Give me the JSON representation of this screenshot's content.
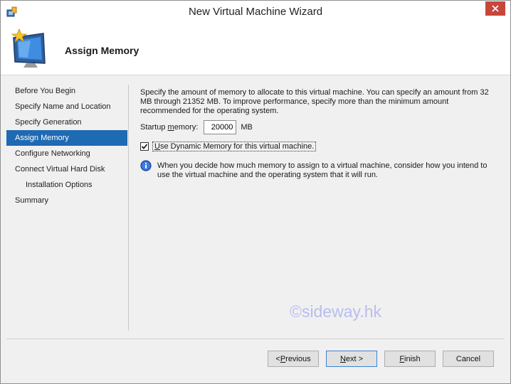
{
  "window": {
    "title": "New Virtual Machine Wizard",
    "close_glyph": "✕"
  },
  "header": {
    "title": "Assign Memory",
    "icon": "new-vm-monitor-icon"
  },
  "sidebar": {
    "items": [
      {
        "label": "Before You Begin",
        "active": false,
        "sub": false
      },
      {
        "label": "Specify Name and Location",
        "active": false,
        "sub": false
      },
      {
        "label": "Specify Generation",
        "active": false,
        "sub": false
      },
      {
        "label": "Assign Memory",
        "active": true,
        "sub": false
      },
      {
        "label": "Configure Networking",
        "active": false,
        "sub": false
      },
      {
        "label": "Connect Virtual Hard Disk",
        "active": false,
        "sub": false
      },
      {
        "label": "Installation Options",
        "active": false,
        "sub": true
      },
      {
        "label": "Summary",
        "active": false,
        "sub": false
      }
    ]
  },
  "main": {
    "description": "Specify the amount of memory to allocate to this virtual machine. You can specify an amount from 32 MB through 21352 MB. To improve performance, specify more than the minimum amount recommended for the operating system.",
    "startup_label_pre": "Startup ",
    "startup_label_accel": "m",
    "startup_label_post": "emory:",
    "startup_value": "20000",
    "startup_unit": "MB",
    "dynamic_memory_checked": true,
    "dynamic_label_accel": "U",
    "dynamic_label_post": "se Dynamic Memory for this virtual machine.",
    "info_text": "When you decide how much memory to assign to a virtual machine, consider how you intend to use the virtual machine and the operating system that it will run."
  },
  "watermark": "©sideway.hk",
  "buttons": {
    "previous_pre": "< ",
    "previous_accel": "P",
    "previous_post": "revious",
    "next_accel": "N",
    "next_post": "ext >",
    "finish_accel": "F",
    "finish_post": "inish",
    "cancel": "Cancel"
  },
  "colors": {
    "accent": "#1e6ab3",
    "close": "#c7463b"
  }
}
